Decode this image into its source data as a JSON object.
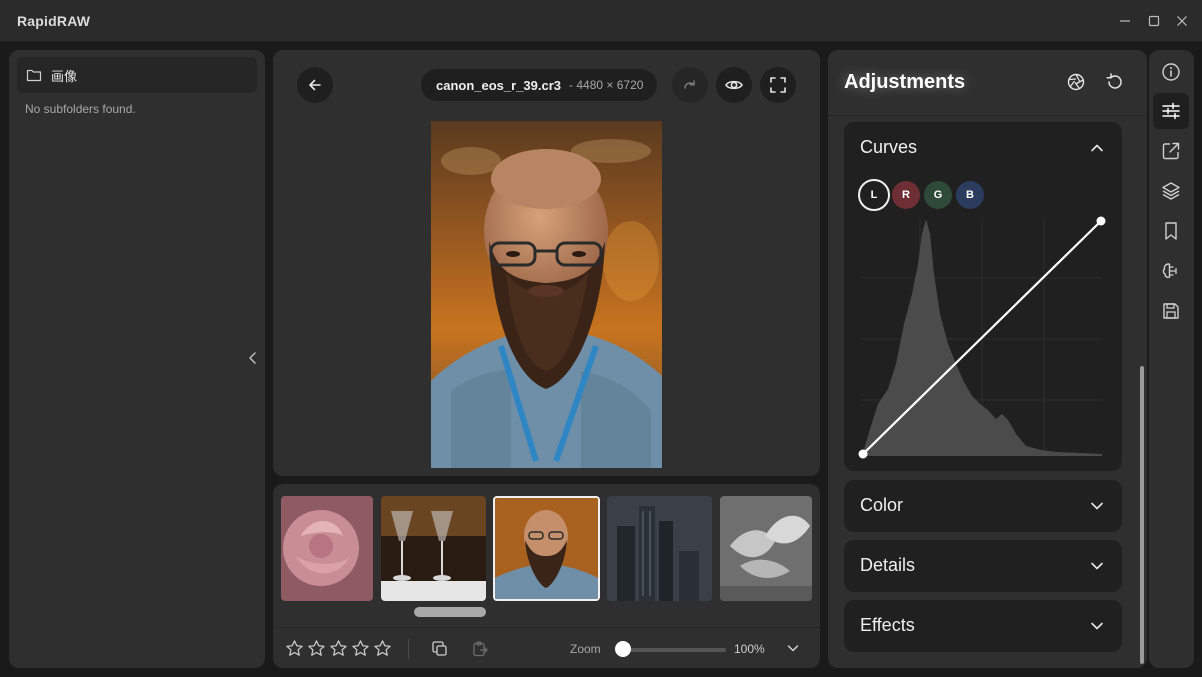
{
  "window": {
    "title": "RapidRAW"
  },
  "folders": {
    "current_folder": "画像",
    "empty_message": "No subfolders found."
  },
  "viewer": {
    "filename": "canon_eos_r_39.cr3",
    "dimensions": "- 4480 × 6720"
  },
  "filmstrip": {
    "thumbnails": [
      {
        "subject": "pink rose",
        "active": false
      },
      {
        "subject": "wine glasses",
        "active": false
      },
      {
        "subject": "bearded man portrait",
        "active": true
      },
      {
        "subject": "skyscrapers",
        "active": false
      },
      {
        "subject": "seagulls",
        "active": false
      }
    ]
  },
  "toolbar": {
    "rating": 0,
    "rating_max": 5,
    "zoom_label": "Zoom",
    "zoom_value": "100%",
    "zoom_level": 0.0
  },
  "adjustments": {
    "title": "Adjustments",
    "sections": {
      "curves": {
        "title": "Curves",
        "expanded": true
      },
      "color": {
        "title": "Color",
        "expanded": false
      },
      "details": {
        "title": "Details",
        "expanded": false
      },
      "effects": {
        "title": "Effects",
        "expanded": false
      }
    },
    "channels": [
      {
        "label": "L",
        "color": "#1c1c1c",
        "active": true
      },
      {
        "label": "R",
        "color": "#6e2e33",
        "active": false
      },
      {
        "label": "G",
        "color": "#2f4a38",
        "active": false
      },
      {
        "label": "B",
        "color": "#2c3c5e",
        "active": false
      }
    ]
  },
  "colors": {
    "panel": "#2f2f2f",
    "background": "#1a1a1a",
    "accent": "#ffffff"
  }
}
